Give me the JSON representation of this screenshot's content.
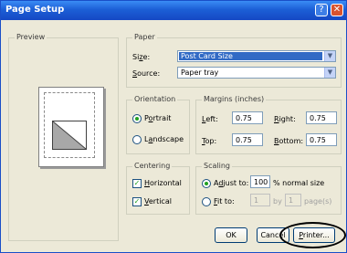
{
  "window": {
    "title": "Page Setup",
    "help_glyph": "?",
    "close_glyph": "✕"
  },
  "preview": {
    "label": "Preview"
  },
  "paper": {
    "label": "Paper",
    "size_label_pre": "Si",
    "size_label_u": "z",
    "size_label_post": "e:",
    "size_value": "Post Card Size",
    "source_label_u": "S",
    "source_label_post": "ource:",
    "source_value": "Paper tray"
  },
  "orientation": {
    "label": "Orientation",
    "portrait_u": "o",
    "portrait_pre": "P",
    "portrait_post": "rtrait",
    "landscape_pre": "L",
    "landscape_u": "a",
    "landscape_post": "ndscape",
    "selected": "Portrait"
  },
  "margins": {
    "label": "Margins (inches)",
    "left_u": "L",
    "left_post": "eft:",
    "left_value": "0.75",
    "right_u": "R",
    "right_post": "ight:",
    "right_value": "0.75",
    "top_u": "T",
    "top_post": "op:",
    "top_value": "0.75",
    "bottom_u": "B",
    "bottom_post": "ottom:",
    "bottom_value": "0.75"
  },
  "centering": {
    "label": "Centering",
    "horizontal_u": "H",
    "horizontal_post": "orizontal",
    "vertical_u": "V",
    "vertical_post": "ertical",
    "horizontal_checked": true,
    "vertical_checked": true
  },
  "scaling": {
    "label": "Scaling",
    "adjust_pre": "A",
    "adjust_u": "d",
    "adjust_post": "just to:",
    "adjust_value": "100",
    "adjust_suffix": "% normal size",
    "fit_u": "F",
    "fit_post": "it to:",
    "fit_pages_wide": "1",
    "fit_by": "by",
    "fit_pages_tall": "1",
    "fit_suffix": "page(s)"
  },
  "buttons": {
    "ok": "OK",
    "cancel": "Cancel",
    "printer_u": "P",
    "printer_post": "rinter..."
  },
  "colors": {
    "title_bar": "#1c5fd6",
    "dialog_bg": "#ece9d8",
    "selection": "#316ac5",
    "radio_dot": "#21a121"
  },
  "icons": {
    "combo_arrow": "chevron-down-icon",
    "checkmark": "checkmark-icon"
  }
}
